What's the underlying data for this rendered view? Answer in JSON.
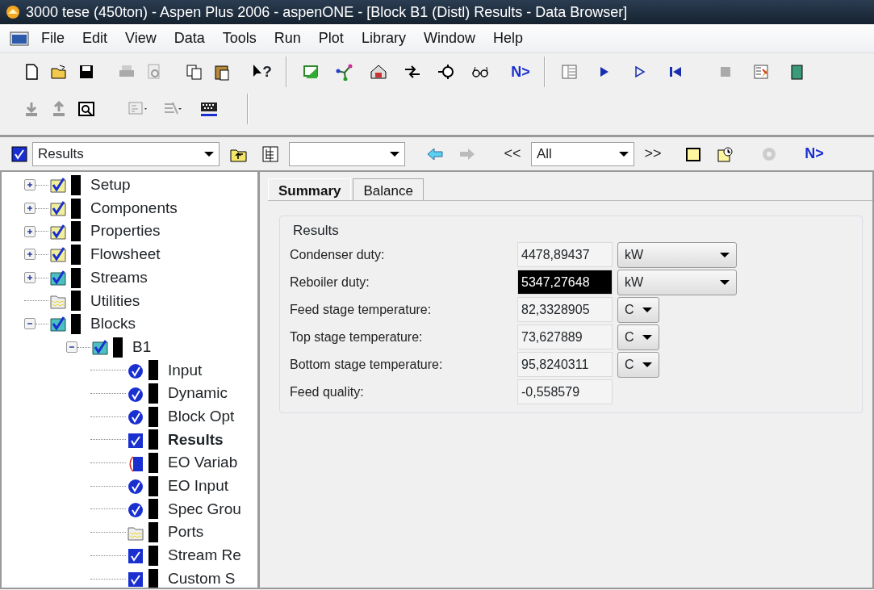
{
  "window": {
    "title": "3000 tese (450ton) - Aspen Plus 2006 - aspenONE - [Block B1 (Distl) Results - Data Browser]"
  },
  "menu": [
    "File",
    "Edit",
    "View",
    "Data",
    "Tools",
    "Run",
    "Plot",
    "Library",
    "Window",
    "Help"
  ],
  "toolbar": {
    "whats_this": "?",
    "next_button": "N>"
  },
  "navigation": {
    "form_combo": {
      "value": "Results"
    },
    "previous_label": "<<",
    "filter_combo": {
      "value": "All"
    },
    "next_label": ">>",
    "next_button": "N>"
  },
  "tree": [
    {
      "label": "Setup",
      "kind": "folder-check",
      "expanded": false,
      "selected": false
    },
    {
      "label": "Components",
      "kind": "folder-check",
      "expanded": false,
      "selected": false
    },
    {
      "label": "Properties",
      "kind": "folder-check",
      "expanded": false,
      "selected": false
    },
    {
      "label": "Flowsheet",
      "kind": "folder-check",
      "expanded": false,
      "selected": false
    },
    {
      "label": "Streams",
      "kind": "folder-check-teal",
      "expanded": false,
      "selected": false
    },
    {
      "label": "Utilities",
      "kind": "folder",
      "selected": false
    },
    {
      "label": "Blocks",
      "kind": "folder-check-teal",
      "expanded": true,
      "selected": false,
      "children": [
        {
          "label": "B1",
          "kind": "folder-check-teal",
          "expanded": true,
          "selected": false,
          "children": [
            {
              "label": "Input",
              "kind": "circle-check",
              "selected": false
            },
            {
              "label": "Dynamic",
              "kind": "circle-check",
              "selected": false
            },
            {
              "label": "Block Opt",
              "kind": "circle-check",
              "selected": false
            },
            {
              "label": "Results",
              "kind": "square-check",
              "selected": true
            },
            {
              "label": "EO Variab",
              "kind": "partial",
              "selected": false
            },
            {
              "label": "EO Input",
              "kind": "circle-check",
              "selected": false
            },
            {
              "label": "Spec Grou",
              "kind": "circle-check",
              "selected": false
            },
            {
              "label": "Ports",
              "kind": "folder",
              "selected": false
            },
            {
              "label": "Stream Re",
              "kind": "square-check",
              "selected": false
            },
            {
              "label": "Custom S",
              "kind": "square-check",
              "selected": false
            }
          ]
        }
      ]
    }
  ],
  "tabs": [
    {
      "label": "Summary",
      "selected": true
    },
    {
      "label": "Balance",
      "selected": false
    }
  ],
  "group": {
    "title": "Results",
    "rows": [
      {
        "label": "Condenser duty:",
        "value": "4478,89437",
        "selected": false,
        "kind": "energy",
        "unit": "kW"
      },
      {
        "label": "Reboiler duty:",
        "value": "5347,27648",
        "selected": true,
        "kind": "energy",
        "unit": "kW"
      },
      {
        "label": "Feed stage temperature:",
        "value": "82,3328905",
        "selected": false,
        "kind": "temperature",
        "unit": "C"
      },
      {
        "label": "Top stage temperature:",
        "value": "73,627889",
        "selected": false,
        "kind": "temperature",
        "unit": "C"
      },
      {
        "label": "Bottom stage temperature:",
        "value": "95,8240311",
        "selected": false,
        "kind": "temperature",
        "unit": "C"
      },
      {
        "label": "Feed quality:",
        "value": "-0,558579",
        "selected": false,
        "kind": "plain"
      }
    ]
  }
}
